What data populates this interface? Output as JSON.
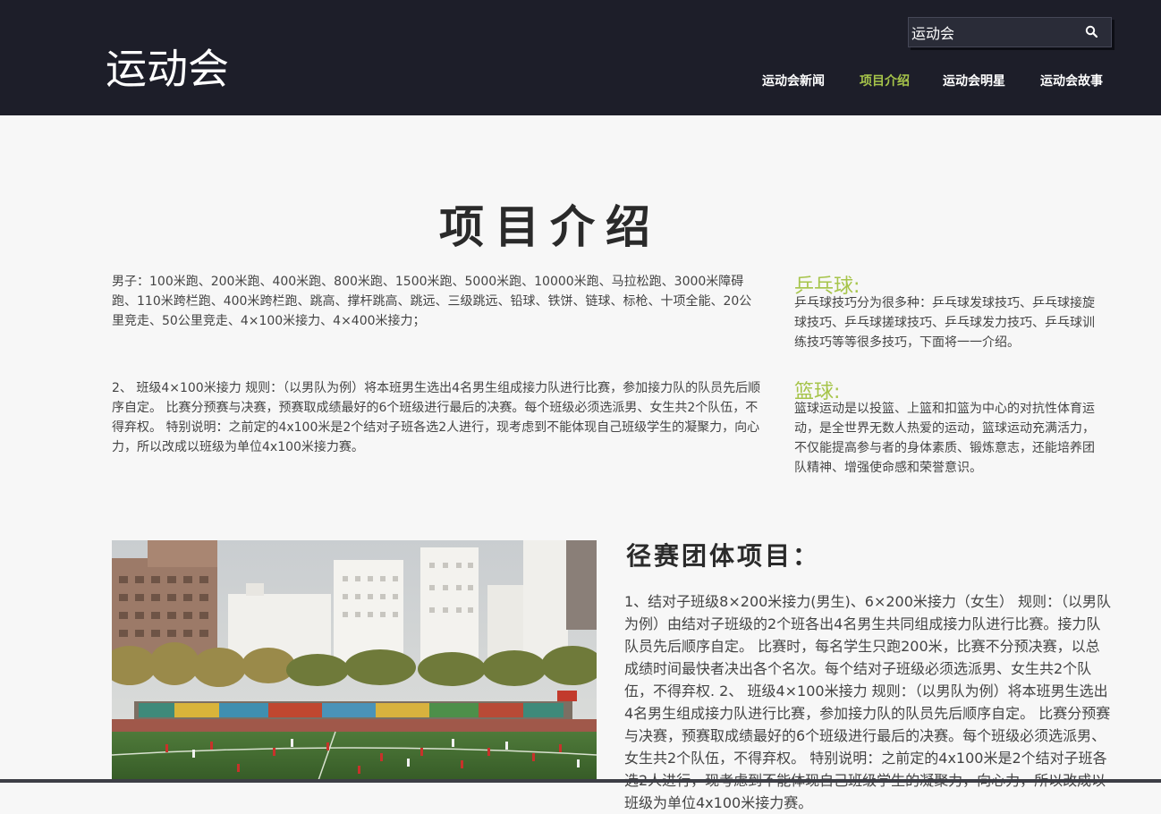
{
  "header": {
    "logo": "运动会",
    "search": {
      "value": "运动会",
      "placeholder": ""
    },
    "nav": [
      {
        "label": "运动会新闻",
        "active": false
      },
      {
        "label": "项目介绍",
        "active": true
      },
      {
        "label": "运动会明星",
        "active": false
      },
      {
        "label": "运动会故事",
        "active": false
      }
    ]
  },
  "main": {
    "title": "项目介绍",
    "intro_paragraph_1": "男子：100米跑、200米跑、400米跑、800米跑、1500米跑、5000米跑、10000米跑、马拉松跑、3000米障碍跑、110米跨栏跑、400米跨栏跑、跳高、撑杆跳高、跳远、三级跳远、铅球、铁饼、链球、标枪、十项全能、20公里竞走、50公里竞走、4×100米接力、4×400米接力；",
    "intro_paragraph_2": "2、 班级4×100米接力 规则：（以男队为例）将本班男生选出4名男生组成接力队进行比赛，参加接力队的队员先后顺序自定。 比赛分预赛与决赛，预赛取成绩最好的6个班级进行最后的决赛。每个班级必须选派男、女生共2个队伍，不得弃权。 特别说明：之前定的4x100米是2个结对子班各选2人进行，现考虑到不能体现自己班级学生的凝聚力，向心力，所以改成以班级为单位4x100米接力赛。",
    "sidebar": [
      {
        "heading": "乒乓球:",
        "text": "乒乓球技巧分为很多种：乒乓球发球技巧、乒乓球接旋球技巧、乒乓球搓球技巧、乒乓球发力技巧、乒乓球训练技巧等等很多技巧，下面将一一介绍。"
      },
      {
        "heading": "篮球:",
        "text": "篮球运动是以投篮、上篮和扣篮为中心的对抗性体育运动，是全世界无数人热爱的运动，篮球运动充满活力，不仅能提高参与者的身体素质、锻炼意志，还能培养团队精神、增强使命感和荣誉意识。"
      }
    ],
    "section": {
      "heading": "径赛团体项目：",
      "text": "1、结对子班级8×200米接力(男生)、6×200米接力（女生） 规则：（以男队为例）由结对子班级的2个班各出4名男生共同组成接力队进行比赛。接力队队员先后顺序自定。 比赛时，每名学生只跑200米，比赛不分预决赛，以总成绩时间最快者决出各个名次。每个结对子班级必须选派男、女生共2个队伍，不得弃权. 2、 班级4×100米接力 规则：（以男队为例）将本班男生选出4名男生组成接力队进行比赛，参加接力队的队员先后顺序自定。 比赛分预赛与决赛，预赛取成绩最好的6个班级进行最后的决赛。每个班级必须选派男、女生共2个队伍，不得弃权。 特别说明：之前定的4x100米是2个结对子班各选2人进行，现考虑到不能体现自己班级学生的凝聚力，向心力，所以改成以班级为单位4x100米接力赛。"
    }
  },
  "colors": {
    "header_bg": "#1d1e29",
    "accent": "#a6c44a",
    "page_bg": "#f7f7f7"
  }
}
